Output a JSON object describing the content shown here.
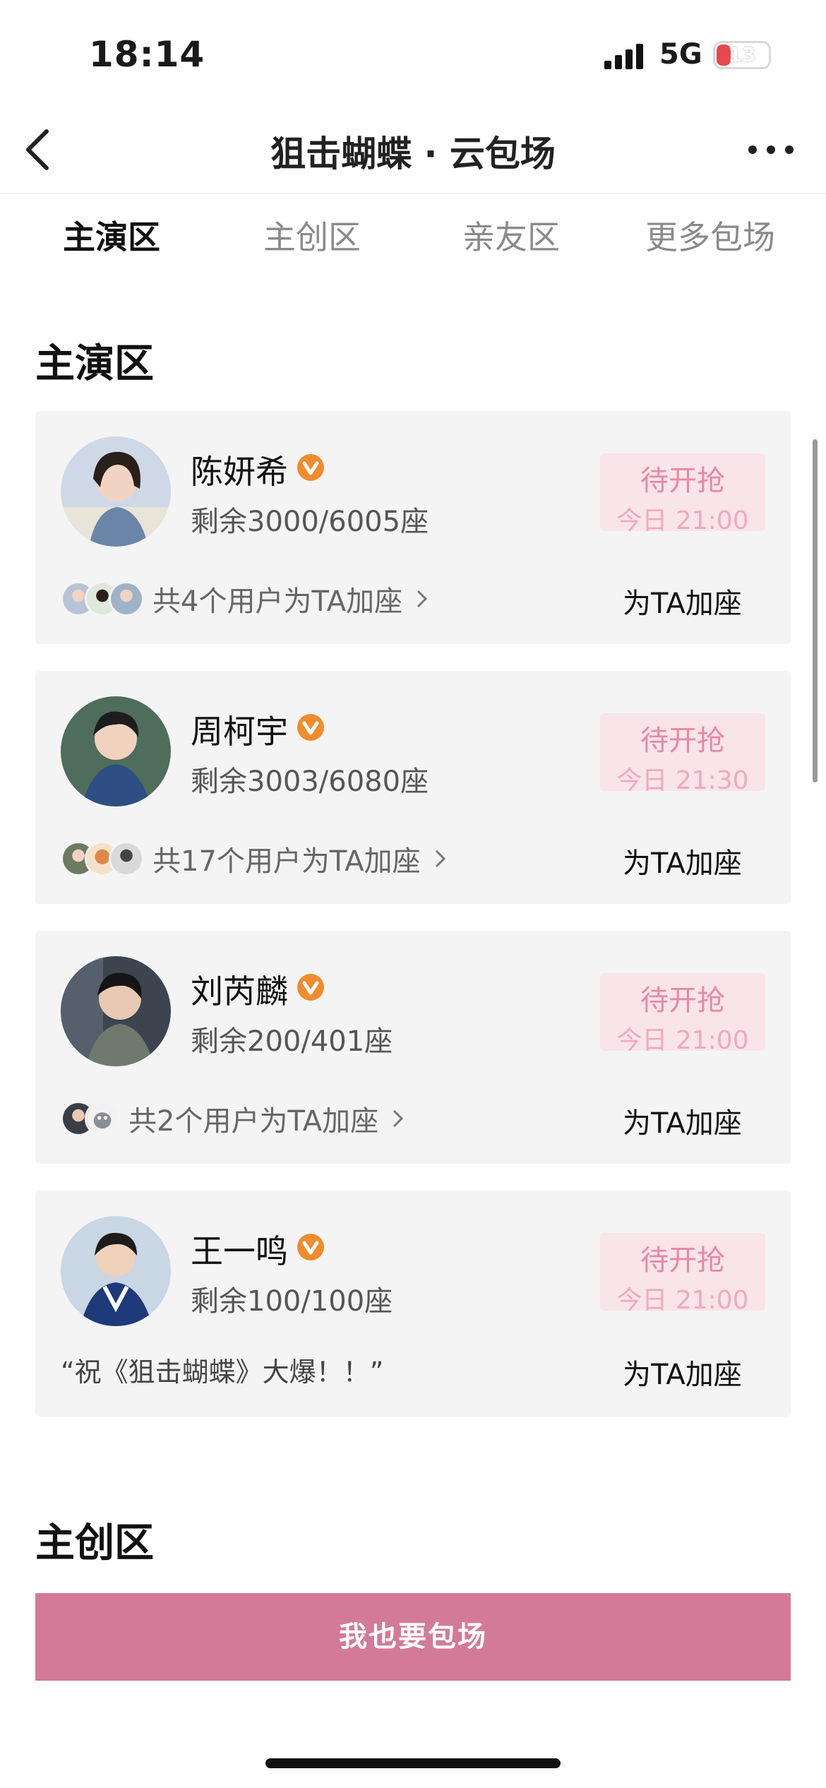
{
  "status_bar": {
    "time": "18:14",
    "network": "5G",
    "battery": "13"
  },
  "nav": {
    "title": "狙击蝴蝶 · 云包场"
  },
  "tabs": [
    {
      "label": "主演区",
      "active": true
    },
    {
      "label": "主创区",
      "active": false
    },
    {
      "label": "亲友区",
      "active": false
    },
    {
      "label": "更多包场",
      "active": false
    }
  ],
  "sections": {
    "lead": "主演区",
    "creators": "主创区"
  },
  "cards": [
    {
      "name": "陈妍希",
      "seats": "剩余3000/6005座",
      "status": "待开抢",
      "time": "今日 21:00",
      "supporters": "共4个用户为TA加座",
      "action": "为TA加座"
    },
    {
      "name": "周柯宇",
      "seats": "剩余3003/6080座",
      "status": "待开抢",
      "time": "今日 21:30",
      "supporters": "共17个用户为TA加座",
      "action": "为TA加座"
    },
    {
      "name": "刘芮麟",
      "seats": "剩余200/401座",
      "status": "待开抢",
      "time": "今日 21:00",
      "supporters": "共2个用户为TA加座",
      "action": "为TA加座"
    },
    {
      "name": "王一鸣",
      "seats": "剩余100/100座",
      "status": "待开抢",
      "time": "今日 21:00",
      "quote": "“祝《狙击蝴蝶》大爆！！”",
      "action": "为TA加座"
    }
  ],
  "cta": {
    "label": "我也要包场"
  },
  "colors": {
    "accent": "#d37a98",
    "badge": "#f08c2e",
    "grab_bg": "#f9e4ea",
    "grab_text": "#e58aa4"
  }
}
